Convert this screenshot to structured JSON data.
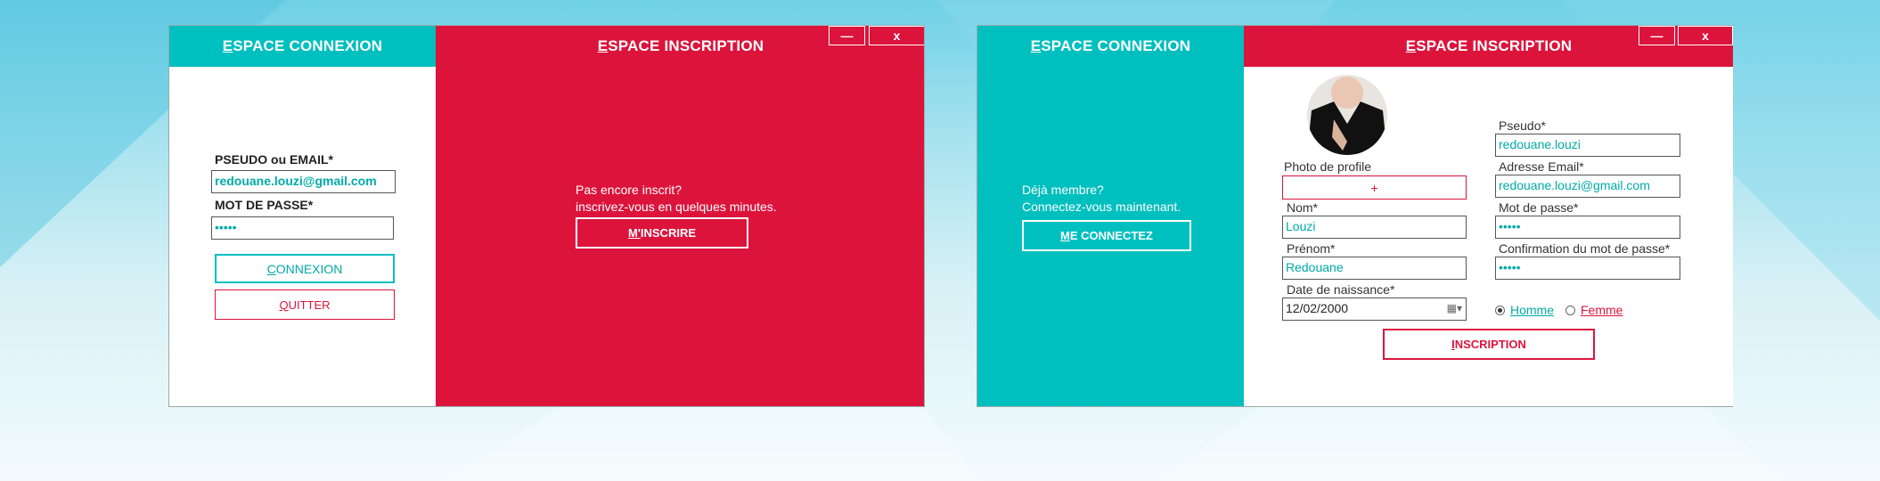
{
  "colors": {
    "teal": "#00bfbf",
    "red": "#dc143c"
  },
  "window_controls": {
    "minimize": "—",
    "close": "x"
  },
  "screen1": {
    "login_header": "ESPACE CONNEXION",
    "register_header": "ESPACE INSCRIPTION",
    "pseudo_label": "PSEUDO ou EMAIL*",
    "pseudo_value": "redouane.louzi@gmail.com",
    "password_label": "MOT DE PASSE*",
    "password_value": "•••••",
    "connexion_button": "CONNEXION",
    "quitter_button": "QUITTER",
    "promo_line1": "Pas encore inscrit?",
    "promo_line2": "inscrivez-vous en quelques minutes.",
    "inscrire_button": "M'INSCRIRE"
  },
  "screen2": {
    "login_header": "ESPACE CONNEXION",
    "register_header": "ESPACE INSCRIPTION",
    "member_line1": "Déjà membre?",
    "member_line2": "Connectez-vous maintenant.",
    "connect_button": "ME CONNECTEZ",
    "photo_label": "Photo de profile",
    "photo_add": "+",
    "nom_label": "Nom*",
    "nom_value": "Louzi",
    "prenom_label": "Prénom*",
    "prenom_value": "Redouane",
    "birth_label": "Date de naissance*",
    "birth_value": "12/02/2000",
    "pseudo_label": "Pseudo*",
    "pseudo_value": "redouane.louzi",
    "email_label": "Adresse Email*",
    "email_value": "redouane.louzi@gmail.com",
    "password_label": "Mot de passe*",
    "password_value": "•••••",
    "confirm_label": "Confirmation du mot de passe*",
    "confirm_value": "•••••",
    "gender_male": "Homme",
    "gender_female": "Femme",
    "gender_selected": "Homme",
    "inscription_button": "INSCRIPTION"
  }
}
